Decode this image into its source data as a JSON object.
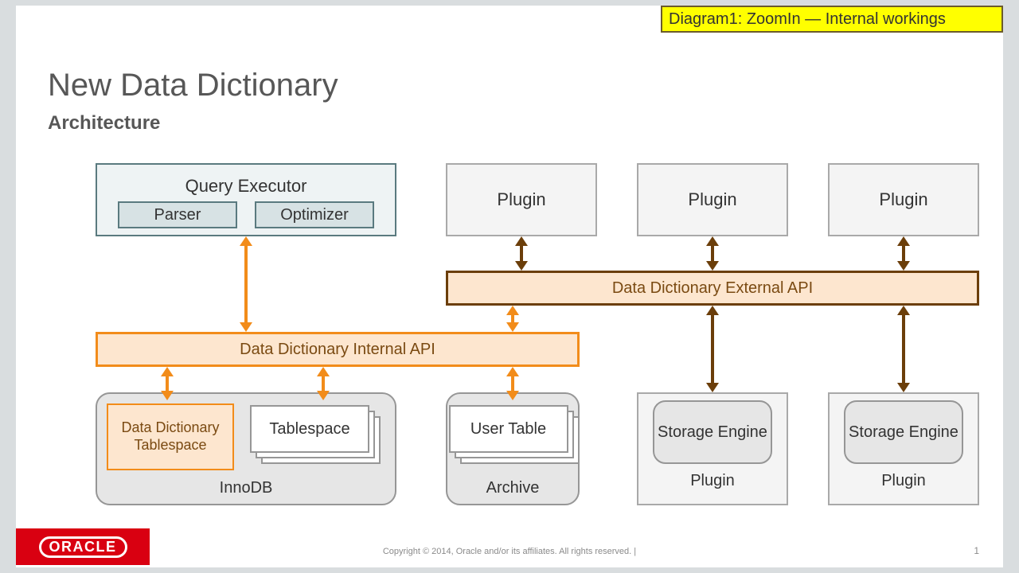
{
  "banner": "Diagram1:  ZoomIn — Internal workings",
  "title": "New Data Dictionary",
  "subtitle": "Architecture",
  "query_executor": {
    "label": "Query Executor",
    "parser": "Parser",
    "optimizer": "Optimizer"
  },
  "plugins_top": [
    "Plugin",
    "Plugin",
    "Plugin"
  ],
  "api_external": "Data Dictionary External API",
  "api_internal": "Data Dictionary Internal API",
  "innodb": {
    "caption": "InnoDB",
    "dd_tablespace": "Data Dictionary Tablespace",
    "tablespace": "Tablespace"
  },
  "archive": {
    "caption": "Archive",
    "user_table": "User Table"
  },
  "storage_plugins": [
    {
      "inner": "Storage Engine",
      "caption": "Plugin"
    },
    {
      "inner": "Storage Engine",
      "caption": "Plugin"
    }
  ],
  "footer": {
    "copyright": "Copyright © 2014, Oracle and/or its affiliates. All rights reserved.  |",
    "page": "1",
    "brand": "ORACLE"
  },
  "colors": {
    "orange": "#f28c1a",
    "brown": "#6b3e0a",
    "peach": "#fde6cf",
    "grey_box": "#e6e6e6",
    "light_box": "#f4f4f4"
  }
}
